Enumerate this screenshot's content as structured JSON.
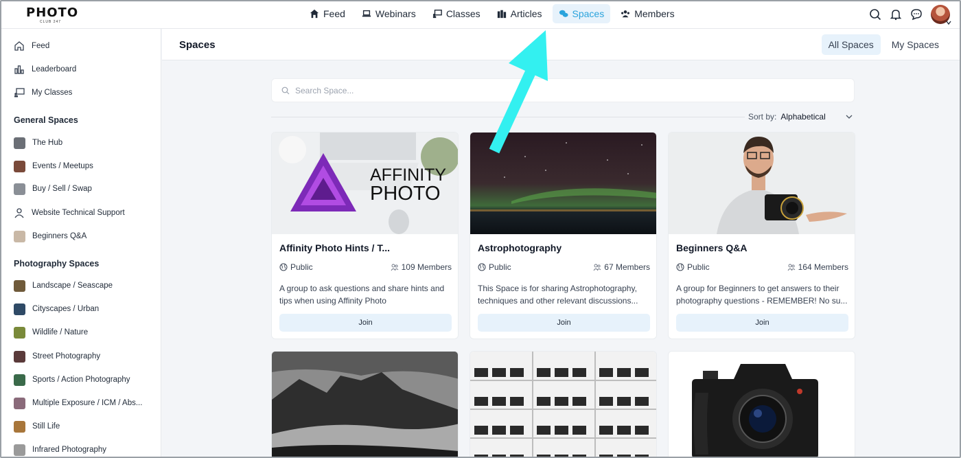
{
  "logo": {
    "word": "PHOTO",
    "sub": "CLUB 247"
  },
  "nav": [
    {
      "label": "Feed",
      "icon": "home-icon",
      "active": false
    },
    {
      "label": "Webinars",
      "icon": "laptop-icon",
      "active": false
    },
    {
      "label": "Classes",
      "icon": "presentation-icon",
      "active": false
    },
    {
      "label": "Articles",
      "icon": "books-icon",
      "active": false
    },
    {
      "label": "Spaces",
      "icon": "chat-bubbles-icon",
      "active": true
    },
    {
      "label": "Members",
      "icon": "users-icon",
      "active": false
    }
  ],
  "sidebar": {
    "top": [
      {
        "label": "Feed",
        "icon": "home-icon"
      },
      {
        "label": "Leaderboard",
        "icon": "bar-chart-icon"
      },
      {
        "label": "My Classes",
        "icon": "presentation-icon"
      }
    ],
    "general_heading": "General Spaces",
    "general": [
      {
        "label": "The Hub",
        "color": "#6b6f76"
      },
      {
        "label": "Events / Meetups",
        "color": "#7a4a3a"
      },
      {
        "label": "Buy / Sell / Swap",
        "color": "#8a8f96"
      },
      {
        "label": "Website Technical Support",
        "color": "icon"
      },
      {
        "label": "Beginners Q&A",
        "color": "#c9b8a6"
      }
    ],
    "photo_heading": "Photography Spaces",
    "photo": [
      {
        "label": "Landscape / Seascape",
        "color": "#6f5a3a"
      },
      {
        "label": "Cityscapes / Urban",
        "color": "#2f4a66"
      },
      {
        "label": "Wildlife / Nature",
        "color": "#7a8a3a"
      },
      {
        "label": "Street Photography",
        "color": "#5a3a3a"
      },
      {
        "label": "Sports / Action Photography",
        "color": "#3a6a4a"
      },
      {
        "label": "Multiple Exposure / ICM / Abs...",
        "color": "#8a6a7a"
      },
      {
        "label": "Still Life",
        "color": "#a8763a"
      },
      {
        "label": "Infrared Photography",
        "color": "#9a9a9a"
      }
    ]
  },
  "main": {
    "title": "Spaces",
    "tabs": [
      {
        "label": "All Spaces",
        "active": true
      },
      {
        "label": "My Spaces",
        "active": false
      }
    ],
    "search_placeholder": "Search Space...",
    "sort_label": "Sort by:",
    "sort_value": "Alphabetical",
    "cards": [
      {
        "title": "Affinity Photo Hints / T...",
        "visibility": "Public",
        "members": "109 Members",
        "desc": "A group to ask questions and share hints and tips when using Affinity Photo",
        "join": "Join",
        "art_lines": [
          "AFFINITY",
          "PHOTO"
        ]
      },
      {
        "title": "Astrophotography",
        "visibility": "Public",
        "members": "67 Members",
        "desc": "This Space is for sharing Astrophotography, techniques and other relevant discussions...",
        "join": "Join"
      },
      {
        "title": "Beginners Q&A",
        "visibility": "Public",
        "members": "164 Members",
        "desc": "A group for Beginners to get answers to their photography questions - REMEMBER! No su...",
        "join": "Join"
      }
    ]
  },
  "colors": {
    "accent": "#2aa3dc",
    "accent_bg": "#e7f2fb",
    "arrow": "#33f0f0"
  }
}
